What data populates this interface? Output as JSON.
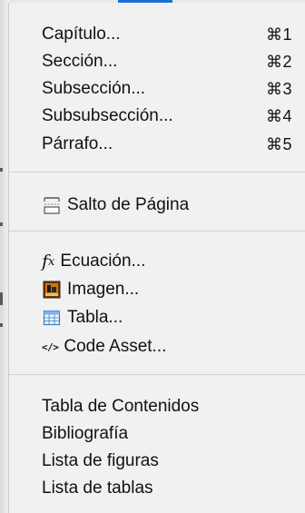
{
  "menu": {
    "sections": {
      "headings": [
        {
          "label": "Capítulo...",
          "shortcut": "⌘1"
        },
        {
          "label": "Sección...",
          "shortcut": "⌘2"
        },
        {
          "label": "Subsección...",
          "shortcut": "⌘3"
        },
        {
          "label": "Subsubsección...",
          "shortcut": "⌘4"
        },
        {
          "label": "Párrafo...",
          "shortcut": "⌘5"
        }
      ],
      "page_break": {
        "label": "Salto de Página",
        "icon": "page-break-icon"
      },
      "inserts": [
        {
          "label": "Ecuación...",
          "icon": "equation-icon",
          "glyph": "f",
          "glyph_sub": "x"
        },
        {
          "label": "Imagen...",
          "icon": "image-icon"
        },
        {
          "label": "Tabla...",
          "icon": "table-icon"
        },
        {
          "label": "Code Asset...",
          "icon": "code-icon",
          "glyph": "</>"
        }
      ],
      "lists": [
        {
          "label": "Tabla de Contenidos"
        },
        {
          "label": "Bibliografía"
        },
        {
          "label": "Lista de figuras"
        },
        {
          "label": "Lista de tablas"
        }
      ]
    }
  },
  "colors": {
    "menu_background": "#f1f1f1",
    "text": "#111111",
    "separator": "#d2d2d2",
    "accent_blue": "#1f6fd6"
  }
}
